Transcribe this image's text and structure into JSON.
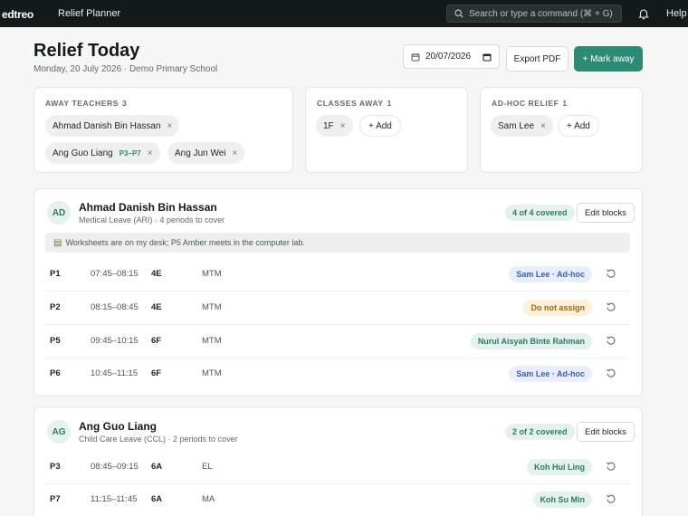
{
  "topbar": {
    "logo": "edtreo",
    "app_name": "Relief Planner",
    "search_placeholder": "Search or type a command (⌘ + G)",
    "help": "Help ·"
  },
  "header": {
    "title": "Relief Today",
    "subtitle": "Monday, 20 July 2026 · Demo Primary School",
    "date_value": "20/07/2026",
    "export_label": "Export PDF",
    "mark_away_label": "+ Mark away"
  },
  "away_teachers": {
    "heading": "AWAY TEACHERS",
    "count": "3",
    "chips": [
      {
        "name": "Ahmad Danish Bin Hassan",
        "tag": ""
      },
      {
        "name": "Ang Guo Liang",
        "tag": "P3–P7"
      },
      {
        "name": "Ang Jun Wei",
        "tag": ""
      }
    ]
  },
  "classes_away": {
    "heading": "CLASSES AWAY",
    "count": "1",
    "chips": [
      {
        "name": "1F"
      }
    ],
    "add_label": "+ Add"
  },
  "adhoc_relief": {
    "heading": "AD-HOC RELIEF",
    "count": "1",
    "chips": [
      {
        "name": "Sam Lee"
      }
    ],
    "add_label": "+ Add"
  },
  "teachers": [
    {
      "initials": "AD",
      "name": "Ahmad Danish Bin Hassan",
      "subtitle": "Medical Leave (ARI) · 4 periods to cover",
      "covered": "4 of 4 covered",
      "edit_label": "Edit blocks",
      "note": "Worksheets are on my desk; P5 Amber meets in the computer lab.",
      "rows": [
        {
          "period": "P1",
          "time": "07:45–08:15",
          "class": "4E",
          "subject": "MTM",
          "assignee": "Sam Lee · Ad-hoc",
          "status": "blue"
        },
        {
          "period": "P2",
          "time": "08:15–08:45",
          "class": "4E",
          "subject": "MTM",
          "assignee": "Do not assign",
          "status": "amber"
        },
        {
          "period": "P5",
          "time": "09:45–10:15",
          "class": "6F",
          "subject": "MTM",
          "assignee": "Nurul Aisyah Binte Rahman",
          "status": "green"
        },
        {
          "period": "P6",
          "time": "10:45–11:15",
          "class": "6F",
          "subject": "MTM",
          "assignee": "Sam Lee · Ad-hoc",
          "status": "blue"
        }
      ]
    },
    {
      "initials": "AG",
      "name": "Ang Guo Liang",
      "subtitle": "Child Care Leave (CCL) · 2 periods to cover",
      "covered": "2 of 2 covered",
      "edit_label": "Edit blocks",
      "rows": [
        {
          "period": "P3",
          "time": "08:45–09:15",
          "class": "6A",
          "subject": "EL",
          "assignee": "Koh Hui Ling",
          "status": "green"
        },
        {
          "period": "P7",
          "time": "11:15–11:45",
          "class": "6A",
          "subject": "MA",
          "assignee": "Koh Su Min",
          "status": "green"
        }
      ]
    }
  ],
  "colors": {
    "accent": "#2d8a74",
    "topbar": "#14191a",
    "adhoc": "#3a5fb0",
    "warning": "#9a6a12"
  }
}
